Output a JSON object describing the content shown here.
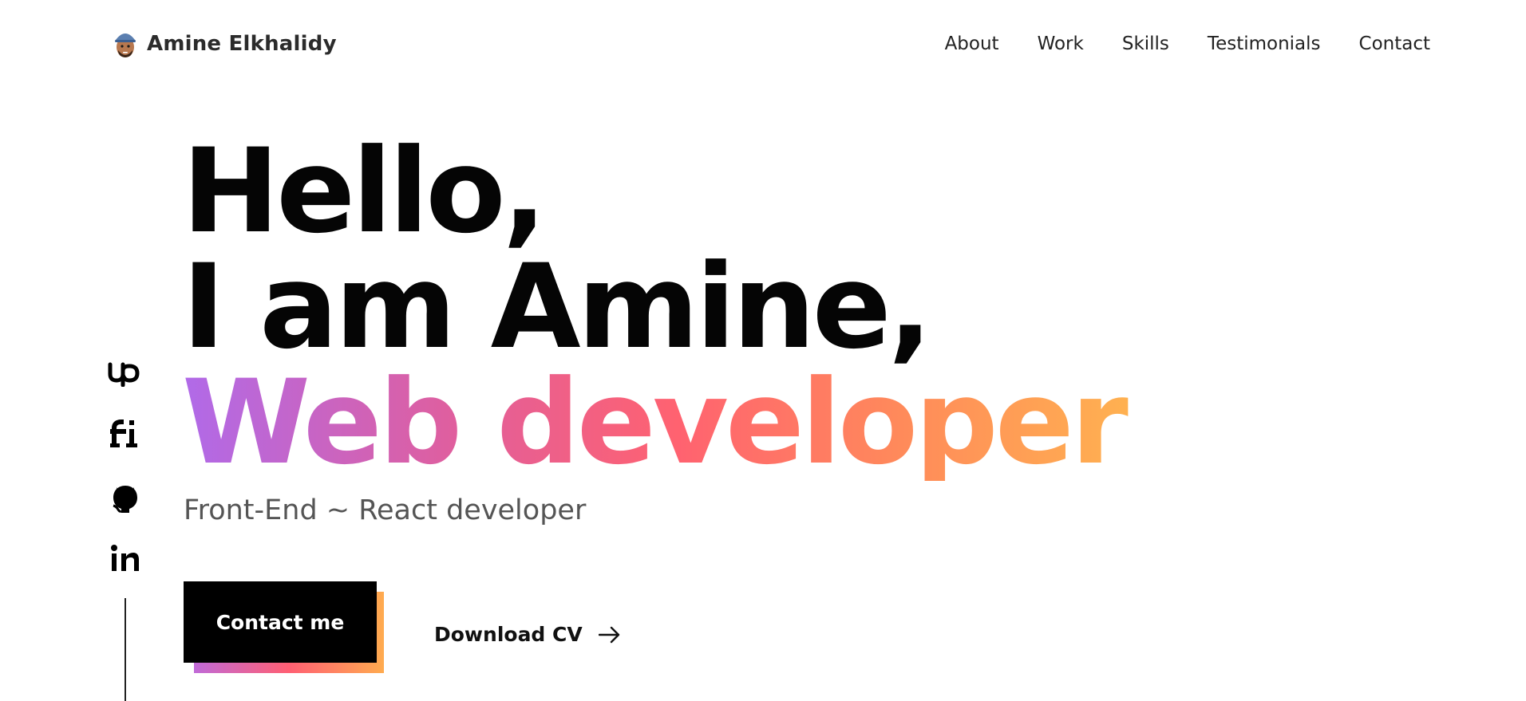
{
  "header": {
    "brand_name": "Amine Elkhalidy",
    "avatar_icon": "memoji-avatar-icon",
    "nav": [
      {
        "label": "About"
      },
      {
        "label": "Work"
      },
      {
        "label": "Skills"
      },
      {
        "label": "Testimonials"
      },
      {
        "label": "Contact"
      }
    ]
  },
  "social": [
    {
      "name": "upwork",
      "icon": "upwork-icon",
      "glyph": "Up"
    },
    {
      "name": "fiverr",
      "icon": "fiverr-icon",
      "glyph": "fi"
    },
    {
      "name": "github",
      "icon": "github-icon"
    },
    {
      "name": "linkedin",
      "icon": "linkedin-icon",
      "glyph": "in"
    }
  ],
  "hero": {
    "line1": "Hello,",
    "line2": "I am Amine,",
    "line3": "Web developer",
    "subtitle": "Front-End ~ React developer",
    "gradient_colors": [
      "#b06ae9",
      "#ff6270",
      "#ffb250"
    ]
  },
  "actions": {
    "contact_label": "Contact me",
    "download_label": "Download CV",
    "download_icon": "arrow-right-icon"
  },
  "colors": {
    "text": "#050505",
    "muted": "#555555",
    "button_bg": "#000000",
    "button_text": "#ffffff"
  }
}
